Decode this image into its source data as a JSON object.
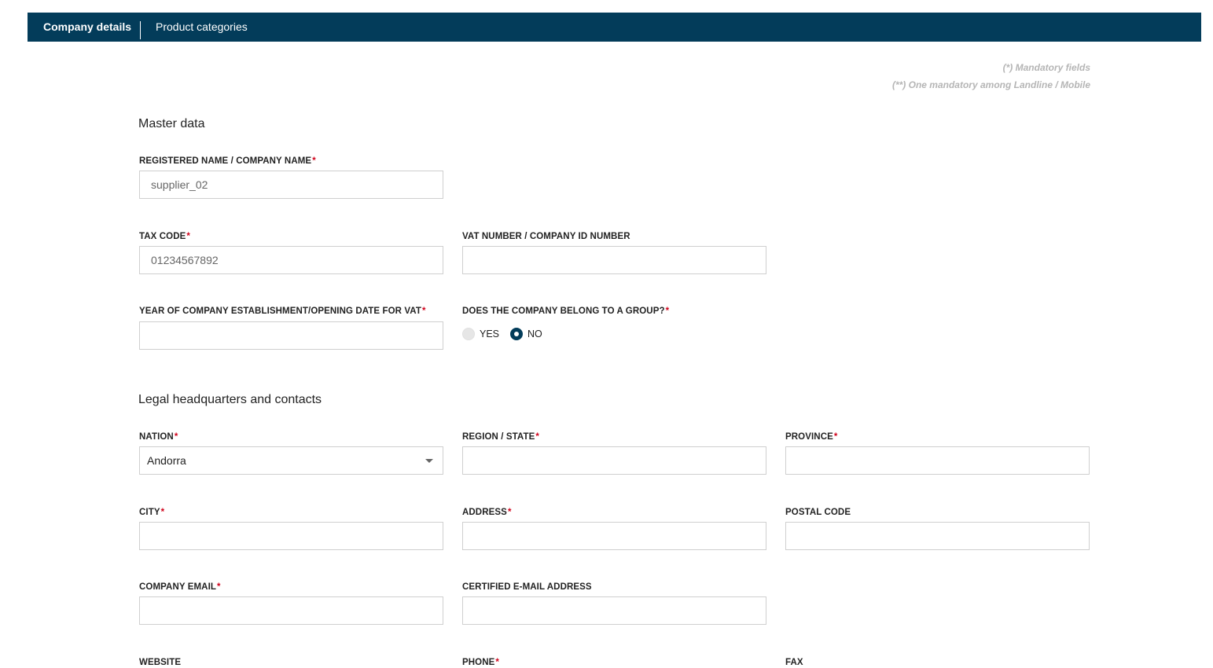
{
  "tabs": {
    "active": "Company details",
    "inactive": "Product categories"
  },
  "notes": {
    "mandatory": "(*) Mandatory fields",
    "one_mandatory": "(**) One mandatory among Landline / Mobile"
  },
  "required_mark": "*",
  "master_data": {
    "title": "Master data",
    "registered_name": {
      "label": "REGISTERED NAME / COMPANY NAME",
      "value": "supplier_02"
    },
    "tax_code": {
      "label": "TAX CODE",
      "value": "01234567892"
    },
    "vat_number": {
      "label": "VAT NUMBER / COMPANY ID NUMBER",
      "value": ""
    },
    "year_established": {
      "label": "YEAR OF COMPANY ESTABLISHMENT/OPENING DATE FOR VAT",
      "value": ""
    },
    "belongs_to_group": {
      "label": "DOES THE COMPANY BELONG TO A GROUP?",
      "options": [
        "YES",
        "NO"
      ],
      "selected": "NO"
    }
  },
  "legal": {
    "title": "Legal headquarters and contacts",
    "nation": {
      "label": "NATION",
      "value": "Andorra"
    },
    "region": {
      "label": "REGION / STATE",
      "value": ""
    },
    "province": {
      "label": "PROVINCE",
      "value": ""
    },
    "city": {
      "label": "CITY",
      "value": ""
    },
    "address": {
      "label": "ADDRESS",
      "value": ""
    },
    "postal_code": {
      "label": "POSTAL CODE",
      "value": ""
    },
    "company_email": {
      "label": "COMPANY EMAIL",
      "value": ""
    },
    "certified_email": {
      "label": "CERTIFIED E-MAIL ADDRESS",
      "value": ""
    },
    "website": {
      "label": "WEBSITE"
    },
    "phone": {
      "label": "PHONE"
    },
    "fax": {
      "label": "FAX"
    }
  },
  "colors": {
    "brand": "#033c5a",
    "required": "#d0021b"
  }
}
